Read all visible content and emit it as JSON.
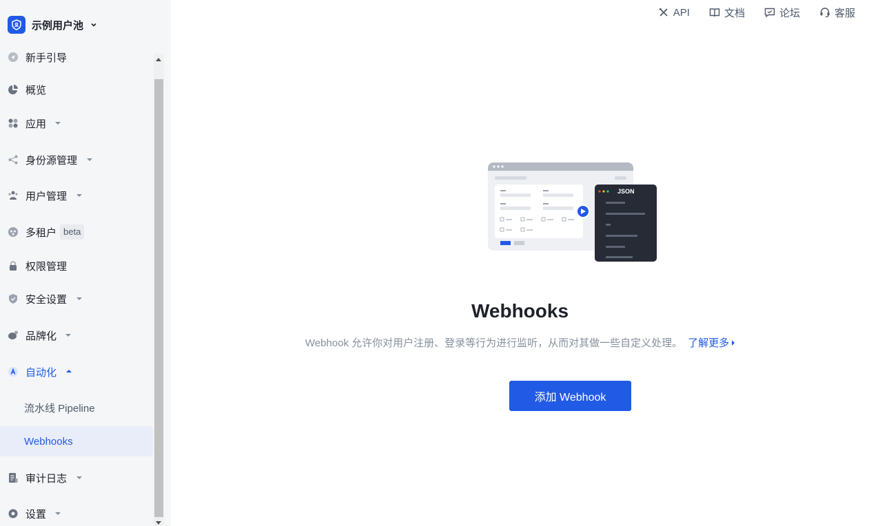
{
  "sidebar": {
    "pool_name": "示例用户池",
    "items": [
      {
        "label": "新手引导"
      },
      {
        "label": "概览"
      },
      {
        "label": "应用"
      },
      {
        "label": "身份源管理"
      },
      {
        "label": "用户管理"
      },
      {
        "label": "多租户",
        "badge": "beta"
      },
      {
        "label": "权限管理"
      },
      {
        "label": "安全设置"
      },
      {
        "label": "品牌化"
      },
      {
        "label": "自动化"
      },
      {
        "label": "审计日志"
      },
      {
        "label": "设置"
      }
    ],
    "sub_items": [
      {
        "label": "流水线 Pipeline"
      },
      {
        "label": "Webhooks"
      }
    ]
  },
  "topnav": {
    "api": "API",
    "docs": "文档",
    "forum": "论坛",
    "support": "客服"
  },
  "main": {
    "illustration_label": "JSON",
    "title": "Webhooks",
    "description": "Webhook 允许你对用户注册、登录等行为进行监听，从而对其做一些自定义处理。",
    "learn_more": "了解更多",
    "add_button": "添加 Webhook"
  },
  "colors": {
    "accent": "#215ae5",
    "sidebar_bg": "#f5f6f8"
  }
}
